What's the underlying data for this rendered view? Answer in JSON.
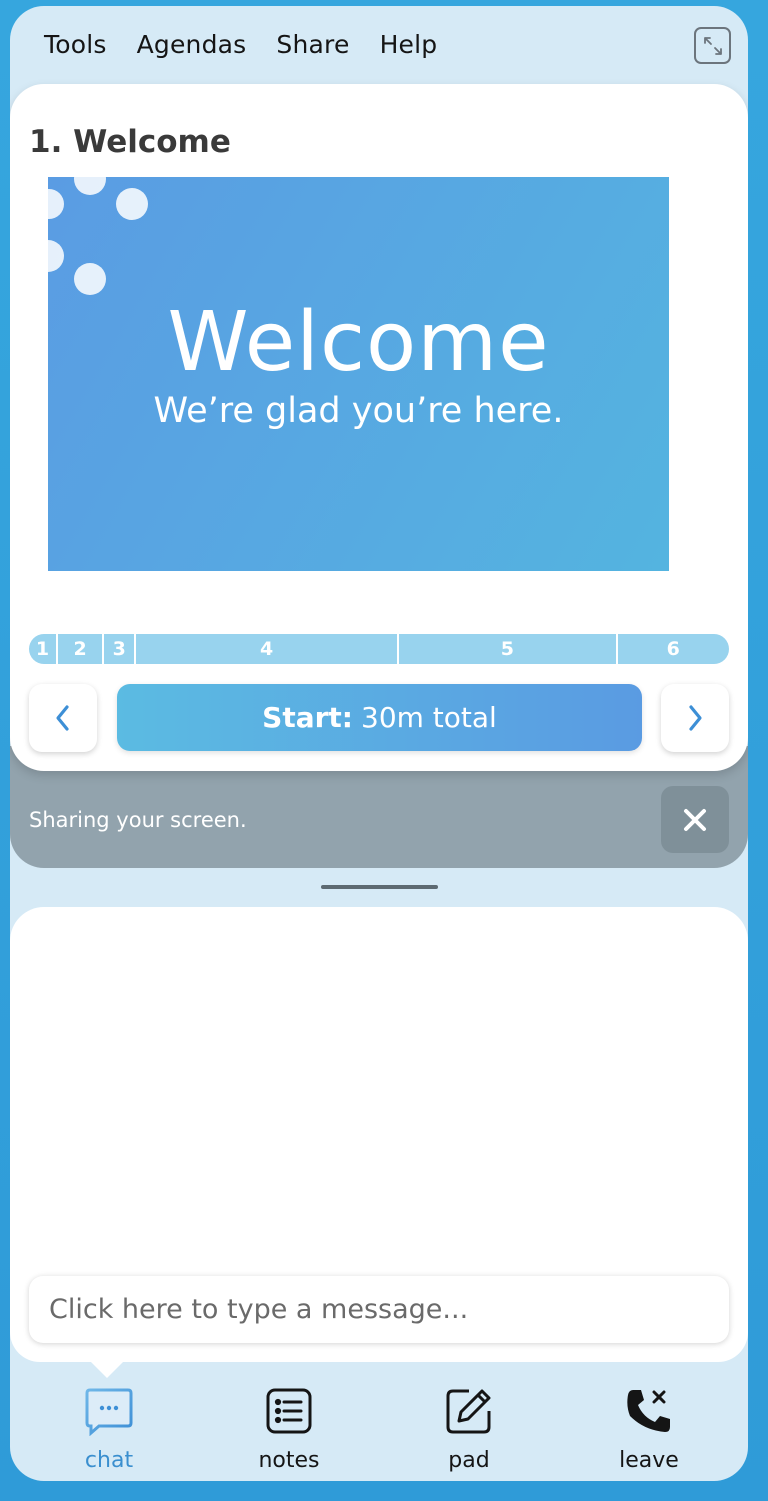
{
  "menu": {
    "items": [
      {
        "label": "Tools"
      },
      {
        "label": "Agendas"
      },
      {
        "label": "Share"
      },
      {
        "label": "Help"
      }
    ],
    "expand_icon": "expand-arrows-icon"
  },
  "agenda": {
    "title": "1. Welcome",
    "slide": {
      "heading": "Welcome",
      "subheading": "We’re glad you’re here."
    },
    "segments": [
      {
        "label": "1",
        "weight": 29
      },
      {
        "label": "2",
        "weight": 46
      },
      {
        "label": "3",
        "weight": 32
      },
      {
        "label": "4",
        "weight": 262
      },
      {
        "label": "5",
        "weight": 218
      },
      {
        "label": "6",
        "weight": 111
      }
    ],
    "start_bold": "Start:",
    "start_rest": "30m total",
    "prev_icon": "chevron-left-icon",
    "next_icon": "chevron-right-icon"
  },
  "share": {
    "text": "Sharing your screen.",
    "close_icon": "close-icon"
  },
  "chat": {
    "placeholder": "Click here to type a message..."
  },
  "tabs": [
    {
      "label": "chat",
      "icon": "chat-bubble-icon",
      "active": true
    },
    {
      "label": "notes",
      "icon": "notes-list-icon",
      "active": false
    },
    {
      "label": "pad",
      "icon": "pencil-pad-icon",
      "active": false
    },
    {
      "label": "leave",
      "icon": "phone-hangup-icon",
      "active": false
    }
  ],
  "colors": {
    "accent": "#3a8fcf",
    "slide_start": "#5a9ce3",
    "slide_end": "#54b4e0",
    "progress": "#98d3ee"
  }
}
